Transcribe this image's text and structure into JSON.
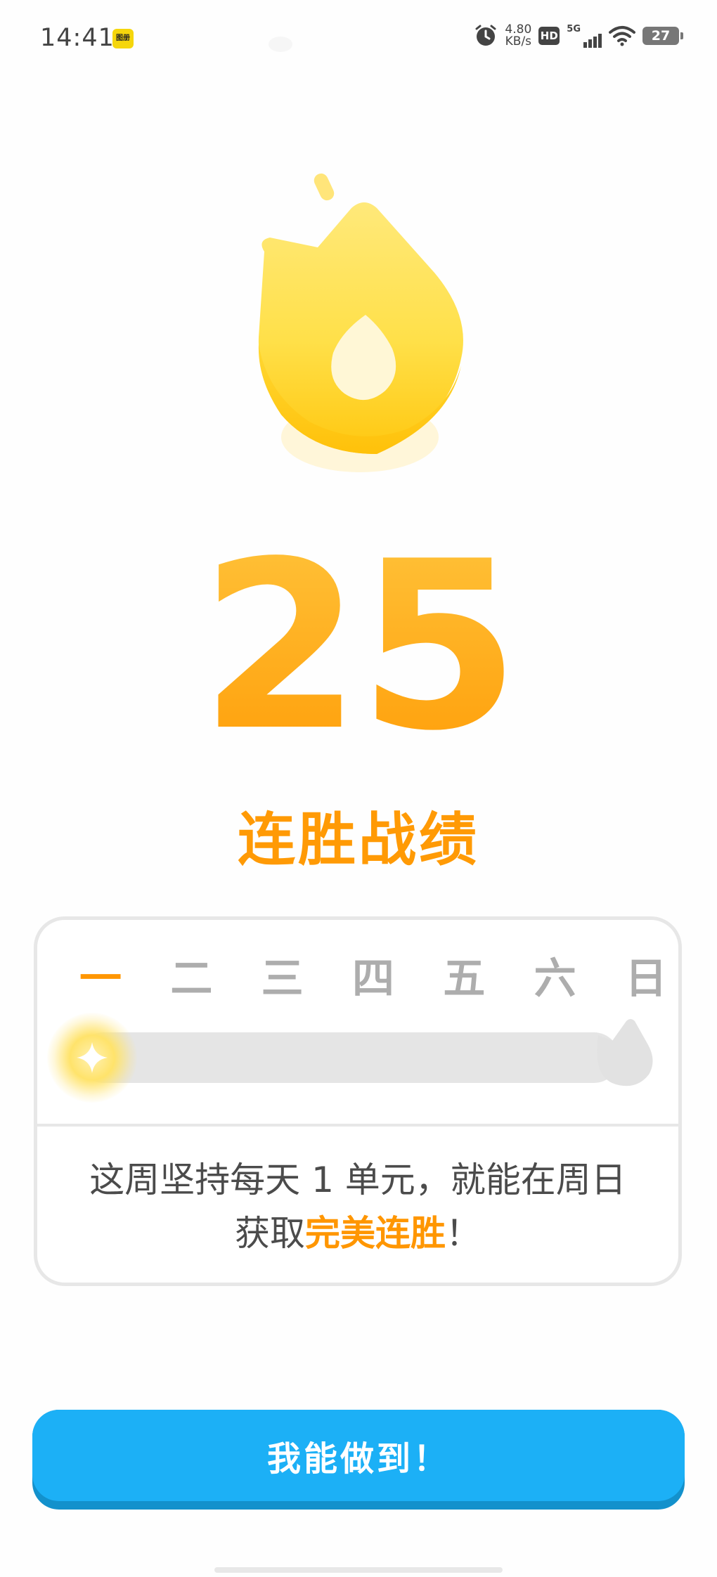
{
  "status_bar": {
    "time": "14:41",
    "notif_badge": "图册",
    "net_speed_value": "4.80",
    "net_speed_unit": "KB/s",
    "hd": "HD",
    "network": "5G",
    "battery": "27"
  },
  "streak": {
    "count": "25",
    "label": "连胜战绩"
  },
  "week": {
    "days": [
      "一",
      "二",
      "三",
      "四",
      "五",
      "六",
      "日"
    ],
    "active_day_index": 0,
    "message_line1": "这周坚持每天 1 单元，就能在周日",
    "message_line2_prefix": "获取",
    "message_highlight": "完美连胜",
    "message_suffix": "！"
  },
  "cta": {
    "label": "我能做到！"
  },
  "colors": {
    "accent_orange": "#ff9600",
    "button_blue": "#1cb0f6",
    "flame_yellow": "#ffd93a"
  },
  "icons": {
    "flame": "flame-icon",
    "start": "sparkle-icon",
    "end": "flame-outline-icon"
  }
}
